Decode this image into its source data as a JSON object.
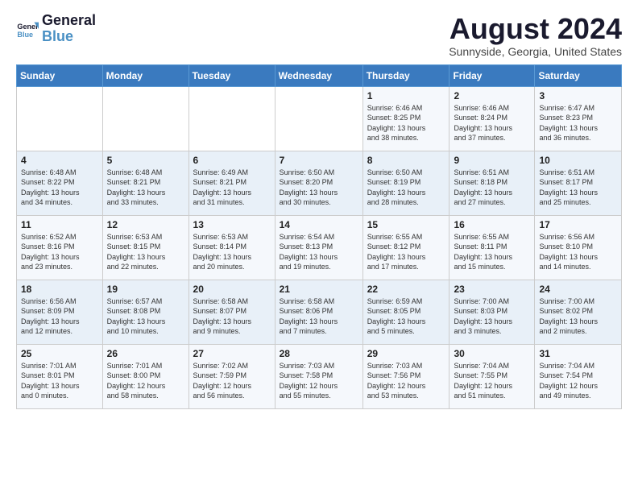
{
  "logo": {
    "line1": "General",
    "line2": "Blue"
  },
  "title": "August 2024",
  "location": "Sunnyside, Georgia, United States",
  "days_of_week": [
    "Sunday",
    "Monday",
    "Tuesday",
    "Wednesday",
    "Thursday",
    "Friday",
    "Saturday"
  ],
  "weeks": [
    [
      {
        "day": "",
        "info": ""
      },
      {
        "day": "",
        "info": ""
      },
      {
        "day": "",
        "info": ""
      },
      {
        "day": "",
        "info": ""
      },
      {
        "day": "1",
        "info": "Sunrise: 6:46 AM\nSunset: 8:25 PM\nDaylight: 13 hours\nand 38 minutes."
      },
      {
        "day": "2",
        "info": "Sunrise: 6:46 AM\nSunset: 8:24 PM\nDaylight: 13 hours\nand 37 minutes."
      },
      {
        "day": "3",
        "info": "Sunrise: 6:47 AM\nSunset: 8:23 PM\nDaylight: 13 hours\nand 36 minutes."
      }
    ],
    [
      {
        "day": "4",
        "info": "Sunrise: 6:48 AM\nSunset: 8:22 PM\nDaylight: 13 hours\nand 34 minutes."
      },
      {
        "day": "5",
        "info": "Sunrise: 6:48 AM\nSunset: 8:21 PM\nDaylight: 13 hours\nand 33 minutes."
      },
      {
        "day": "6",
        "info": "Sunrise: 6:49 AM\nSunset: 8:21 PM\nDaylight: 13 hours\nand 31 minutes."
      },
      {
        "day": "7",
        "info": "Sunrise: 6:50 AM\nSunset: 8:20 PM\nDaylight: 13 hours\nand 30 minutes."
      },
      {
        "day": "8",
        "info": "Sunrise: 6:50 AM\nSunset: 8:19 PM\nDaylight: 13 hours\nand 28 minutes."
      },
      {
        "day": "9",
        "info": "Sunrise: 6:51 AM\nSunset: 8:18 PM\nDaylight: 13 hours\nand 27 minutes."
      },
      {
        "day": "10",
        "info": "Sunrise: 6:51 AM\nSunset: 8:17 PM\nDaylight: 13 hours\nand 25 minutes."
      }
    ],
    [
      {
        "day": "11",
        "info": "Sunrise: 6:52 AM\nSunset: 8:16 PM\nDaylight: 13 hours\nand 23 minutes."
      },
      {
        "day": "12",
        "info": "Sunrise: 6:53 AM\nSunset: 8:15 PM\nDaylight: 13 hours\nand 22 minutes."
      },
      {
        "day": "13",
        "info": "Sunrise: 6:53 AM\nSunset: 8:14 PM\nDaylight: 13 hours\nand 20 minutes."
      },
      {
        "day": "14",
        "info": "Sunrise: 6:54 AM\nSunset: 8:13 PM\nDaylight: 13 hours\nand 19 minutes."
      },
      {
        "day": "15",
        "info": "Sunrise: 6:55 AM\nSunset: 8:12 PM\nDaylight: 13 hours\nand 17 minutes."
      },
      {
        "day": "16",
        "info": "Sunrise: 6:55 AM\nSunset: 8:11 PM\nDaylight: 13 hours\nand 15 minutes."
      },
      {
        "day": "17",
        "info": "Sunrise: 6:56 AM\nSunset: 8:10 PM\nDaylight: 13 hours\nand 14 minutes."
      }
    ],
    [
      {
        "day": "18",
        "info": "Sunrise: 6:56 AM\nSunset: 8:09 PM\nDaylight: 13 hours\nand 12 minutes."
      },
      {
        "day": "19",
        "info": "Sunrise: 6:57 AM\nSunset: 8:08 PM\nDaylight: 13 hours\nand 10 minutes."
      },
      {
        "day": "20",
        "info": "Sunrise: 6:58 AM\nSunset: 8:07 PM\nDaylight: 13 hours\nand 9 minutes."
      },
      {
        "day": "21",
        "info": "Sunrise: 6:58 AM\nSunset: 8:06 PM\nDaylight: 13 hours\nand 7 minutes."
      },
      {
        "day": "22",
        "info": "Sunrise: 6:59 AM\nSunset: 8:05 PM\nDaylight: 13 hours\nand 5 minutes."
      },
      {
        "day": "23",
        "info": "Sunrise: 7:00 AM\nSunset: 8:03 PM\nDaylight: 13 hours\nand 3 minutes."
      },
      {
        "day": "24",
        "info": "Sunrise: 7:00 AM\nSunset: 8:02 PM\nDaylight: 13 hours\nand 2 minutes."
      }
    ],
    [
      {
        "day": "25",
        "info": "Sunrise: 7:01 AM\nSunset: 8:01 PM\nDaylight: 13 hours\nand 0 minutes."
      },
      {
        "day": "26",
        "info": "Sunrise: 7:01 AM\nSunset: 8:00 PM\nDaylight: 12 hours\nand 58 minutes."
      },
      {
        "day": "27",
        "info": "Sunrise: 7:02 AM\nSunset: 7:59 PM\nDaylight: 12 hours\nand 56 minutes."
      },
      {
        "day": "28",
        "info": "Sunrise: 7:03 AM\nSunset: 7:58 PM\nDaylight: 12 hours\nand 55 minutes."
      },
      {
        "day": "29",
        "info": "Sunrise: 7:03 AM\nSunset: 7:56 PM\nDaylight: 12 hours\nand 53 minutes."
      },
      {
        "day": "30",
        "info": "Sunrise: 7:04 AM\nSunset: 7:55 PM\nDaylight: 12 hours\nand 51 minutes."
      },
      {
        "day": "31",
        "info": "Sunrise: 7:04 AM\nSunset: 7:54 PM\nDaylight: 12 hours\nand 49 minutes."
      }
    ]
  ]
}
